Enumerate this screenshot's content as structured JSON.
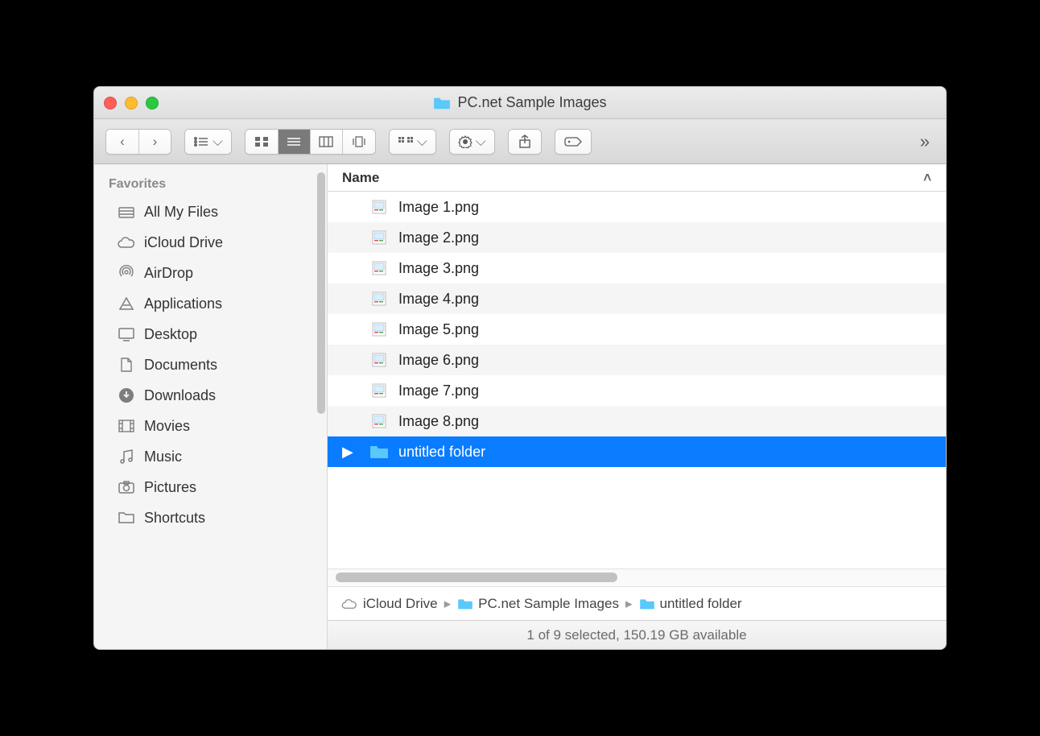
{
  "window": {
    "title": "PC.net Sample Images"
  },
  "sidebar": {
    "section_title": "Favorites",
    "items": [
      {
        "label": "All My Files",
        "icon": "all-my-files-icon"
      },
      {
        "label": "iCloud Drive",
        "icon": "icloud-icon"
      },
      {
        "label": "AirDrop",
        "icon": "airdrop-icon"
      },
      {
        "label": "Applications",
        "icon": "applications-icon"
      },
      {
        "label": "Desktop",
        "icon": "desktop-icon"
      },
      {
        "label": "Documents",
        "icon": "documents-icon"
      },
      {
        "label": "Downloads",
        "icon": "downloads-icon"
      },
      {
        "label": "Movies",
        "icon": "movies-icon"
      },
      {
        "label": "Music",
        "icon": "music-icon"
      },
      {
        "label": "Pictures",
        "icon": "pictures-icon"
      },
      {
        "label": "Shortcuts",
        "icon": "folder-icon"
      }
    ]
  },
  "columns": {
    "name": "Name"
  },
  "files": [
    {
      "name": "Image 1.png",
      "type": "image",
      "selected": false
    },
    {
      "name": "Image 2.png",
      "type": "image",
      "selected": false
    },
    {
      "name": "Image 3.png",
      "type": "image",
      "selected": false
    },
    {
      "name": "Image 4.png",
      "type": "image",
      "selected": false
    },
    {
      "name": "Image 5.png",
      "type": "image",
      "selected": false
    },
    {
      "name": "Image 6.png",
      "type": "image",
      "selected": false
    },
    {
      "name": "Image 7.png",
      "type": "image",
      "selected": false
    },
    {
      "name": "Image 8.png",
      "type": "image",
      "selected": false
    },
    {
      "name": "untitled folder",
      "type": "folder",
      "selected": true
    }
  ],
  "path": [
    {
      "label": "iCloud Drive",
      "icon": "icloud-icon"
    },
    {
      "label": "PC.net Sample Images",
      "icon": "folder-icon"
    },
    {
      "label": "untitled folder",
      "icon": "folder-icon"
    }
  ],
  "status": {
    "text": "1 of 9 selected, 150.19 GB available"
  }
}
